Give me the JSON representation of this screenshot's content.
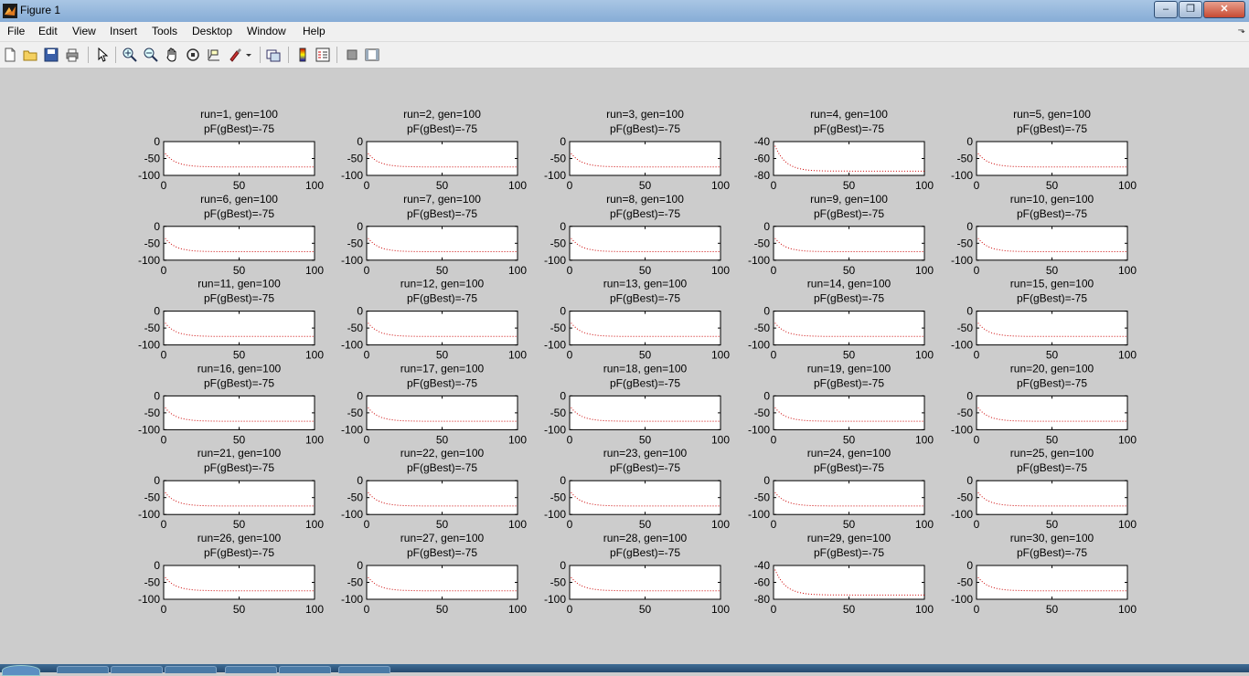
{
  "window": {
    "title": "Figure 1",
    "controls": {
      "minimize": "–",
      "maximize": "❐",
      "close": "✕"
    }
  },
  "menu": [
    "File",
    "Edit",
    "View",
    "Insert",
    "Tools",
    "Desktop",
    "Window",
    "Help"
  ],
  "toolbar": {
    "icons": [
      "new-figure-icon",
      "open-file-icon",
      "save-icon",
      "print-icon",
      "edit-plot-icon",
      "zoom-in-icon",
      "zoom-out-icon",
      "pan-icon",
      "rotate-3d-icon",
      "data-cursor-icon",
      "brush-icon",
      "link-plot-icon",
      "colorbar-icon",
      "legend-icon",
      "hide-plot-tools-icon",
      "show-plot-tools-icon"
    ]
  },
  "colors": {
    "line": "#cc0000",
    "figure_bg": "#cccccc",
    "axes_bg": "#ffffff"
  },
  "chart_data": {
    "type": "line",
    "layout": {
      "rows": 6,
      "cols": 5
    },
    "line_style": "dotted",
    "x_ticks": [
      0,
      50,
      100
    ],
    "xlim": [
      0,
      100
    ],
    "subplots": [
      {
        "title1": "run=1, gen=100",
        "title2": "pF(gBest)=-75",
        "ylim": [
          -100,
          0
        ],
        "y_ticks": [
          0,
          -50,
          -100
        ]
      },
      {
        "title1": "run=2, gen=100",
        "title2": "pF(gBest)=-75",
        "ylim": [
          -100,
          0
        ],
        "y_ticks": [
          0,
          -50,
          -100
        ]
      },
      {
        "title1": "run=3, gen=100",
        "title2": "pF(gBest)=-75",
        "ylim": [
          -100,
          0
        ],
        "y_ticks": [
          0,
          -50,
          -100
        ]
      },
      {
        "title1": "run=4, gen=100",
        "title2": "pF(gBest)=-75",
        "ylim": [
          -80,
          -40
        ],
        "y_ticks": [
          -40,
          -60,
          -80
        ]
      },
      {
        "title1": "run=5, gen=100",
        "title2": "pF(gBest)=-75",
        "ylim": [
          -100,
          0
        ],
        "y_ticks": [
          0,
          -50,
          -100
        ]
      },
      {
        "title1": "run=6, gen=100",
        "title2": "pF(gBest)=-75",
        "ylim": [
          -100,
          0
        ],
        "y_ticks": [
          0,
          -50,
          -100
        ]
      },
      {
        "title1": "run=7, gen=100",
        "title2": "pF(gBest)=-75",
        "ylim": [
          -100,
          0
        ],
        "y_ticks": [
          0,
          -50,
          -100
        ]
      },
      {
        "title1": "run=8, gen=100",
        "title2": "pF(gBest)=-75",
        "ylim": [
          -100,
          0
        ],
        "y_ticks": [
          0,
          -50,
          -100
        ]
      },
      {
        "title1": "run=9, gen=100",
        "title2": "pF(gBest)=-75",
        "ylim": [
          -100,
          0
        ],
        "y_ticks": [
          0,
          -50,
          -100
        ]
      },
      {
        "title1": "run=10, gen=100",
        "title2": "pF(gBest)=-75",
        "ylim": [
          -100,
          0
        ],
        "y_ticks": [
          0,
          -50,
          -100
        ]
      },
      {
        "title1": "run=11, gen=100",
        "title2": "pF(gBest)=-75",
        "ylim": [
          -100,
          0
        ],
        "y_ticks": [
          0,
          -50,
          -100
        ]
      },
      {
        "title1": "run=12, gen=100",
        "title2": "pF(gBest)=-75",
        "ylim": [
          -100,
          0
        ],
        "y_ticks": [
          0,
          -50,
          -100
        ]
      },
      {
        "title1": "run=13, gen=100",
        "title2": "pF(gBest)=-75",
        "ylim": [
          -100,
          0
        ],
        "y_ticks": [
          0,
          -50,
          -100
        ]
      },
      {
        "title1": "run=14, gen=100",
        "title2": "pF(gBest)=-75",
        "ylim": [
          -100,
          0
        ],
        "y_ticks": [
          0,
          -50,
          -100
        ]
      },
      {
        "title1": "run=15, gen=100",
        "title2": "pF(gBest)=-75",
        "ylim": [
          -100,
          0
        ],
        "y_ticks": [
          0,
          -50,
          -100
        ]
      },
      {
        "title1": "run=16, gen=100",
        "title2": "pF(gBest)=-75",
        "ylim": [
          -100,
          0
        ],
        "y_ticks": [
          0,
          -50,
          -100
        ]
      },
      {
        "title1": "run=17, gen=100",
        "title2": "pF(gBest)=-75",
        "ylim": [
          -100,
          0
        ],
        "y_ticks": [
          0,
          -50,
          -100
        ]
      },
      {
        "title1": "run=18, gen=100",
        "title2": "pF(gBest)=-75",
        "ylim": [
          -100,
          0
        ],
        "y_ticks": [
          0,
          -50,
          -100
        ]
      },
      {
        "title1": "run=19, gen=100",
        "title2": "pF(gBest)=-75",
        "ylim": [
          -100,
          0
        ],
        "y_ticks": [
          0,
          -50,
          -100
        ]
      },
      {
        "title1": "run=20, gen=100",
        "title2": "pF(gBest)=-75",
        "ylim": [
          -100,
          0
        ],
        "y_ticks": [
          0,
          -50,
          -100
        ]
      },
      {
        "title1": "run=21, gen=100",
        "title2": "pF(gBest)=-75",
        "ylim": [
          -100,
          0
        ],
        "y_ticks": [
          0,
          -50,
          -100
        ]
      },
      {
        "title1": "run=22, gen=100",
        "title2": "pF(gBest)=-75",
        "ylim": [
          -100,
          0
        ],
        "y_ticks": [
          0,
          -50,
          -100
        ]
      },
      {
        "title1": "run=23, gen=100",
        "title2": "pF(gBest)=-75",
        "ylim": [
          -100,
          0
        ],
        "y_ticks": [
          0,
          -50,
          -100
        ]
      },
      {
        "title1": "run=24, gen=100",
        "title2": "pF(gBest)=-75",
        "ylim": [
          -100,
          0
        ],
        "y_ticks": [
          0,
          -50,
          -100
        ]
      },
      {
        "title1": "run=25, gen=100",
        "title2": "pF(gBest)=-75",
        "ylim": [
          -100,
          0
        ],
        "y_ticks": [
          0,
          -50,
          -100
        ]
      },
      {
        "title1": "run=26, gen=100",
        "title2": "pF(gBest)=-75",
        "ylim": [
          -100,
          0
        ],
        "y_ticks": [
          0,
          -50,
          -100
        ]
      },
      {
        "title1": "run=27, gen=100",
        "title2": "pF(gBest)=-75",
        "ylim": [
          -100,
          0
        ],
        "y_ticks": [
          0,
          -50,
          -100
        ]
      },
      {
        "title1": "run=28, gen=100",
        "title2": "pF(gBest)=-75",
        "ylim": [
          -100,
          0
        ],
        "y_ticks": [
          0,
          -50,
          -100
        ]
      },
      {
        "title1": "run=29, gen=100",
        "title2": "pF(gBest)=-75",
        "ylim": [
          -80,
          -40
        ],
        "y_ticks": [
          -40,
          -60,
          -80
        ]
      },
      {
        "title1": "run=30, gen=100",
        "title2": "pF(gBest)=-75",
        "ylim": [
          -100,
          0
        ],
        "y_ticks": [
          0,
          -50,
          -100
        ]
      }
    ]
  }
}
